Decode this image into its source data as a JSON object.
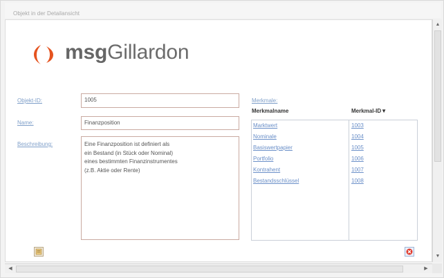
{
  "window": {
    "title": "Objekt in der Detailansicht"
  },
  "brand": {
    "name_bold": "msg",
    "name_regular": "Gillardon",
    "logo_color": "#e5531f"
  },
  "form": {
    "id_label": "Objekt-ID:",
    "id_value": "1005",
    "name_label": "Name:",
    "name_value": "Finanzposition",
    "desc_label": "Beschreibung:",
    "desc_value": "Eine Finanzposition ist definiert als\nein Bestand (in Stück oder Nominal)\neines bestimmten Finanzinstrumentes\n(z.B. Aktie oder Rente)"
  },
  "merkmale": {
    "label": "Merkmale:",
    "col_name": "Merkmalname",
    "col_id": "Merkmal-ID",
    "sort_icon": "sort-descending-icon",
    "rows": [
      {
        "name": "Marktwert",
        "id": "1003"
      },
      {
        "name": "Nominale",
        "id": "1004"
      },
      {
        "name": "Basiswertpapier",
        "id": "1005"
      },
      {
        "name": "Portfolio",
        "id": "1006"
      },
      {
        "name": "Kontrahent",
        "id": "1007"
      },
      {
        "name": "Bestandsschlüssel",
        "id": "1008"
      }
    ]
  },
  "buttons": {
    "left_icon": "edit-icon",
    "right_icon": "close-icon",
    "close_color": "#e0392b"
  }
}
